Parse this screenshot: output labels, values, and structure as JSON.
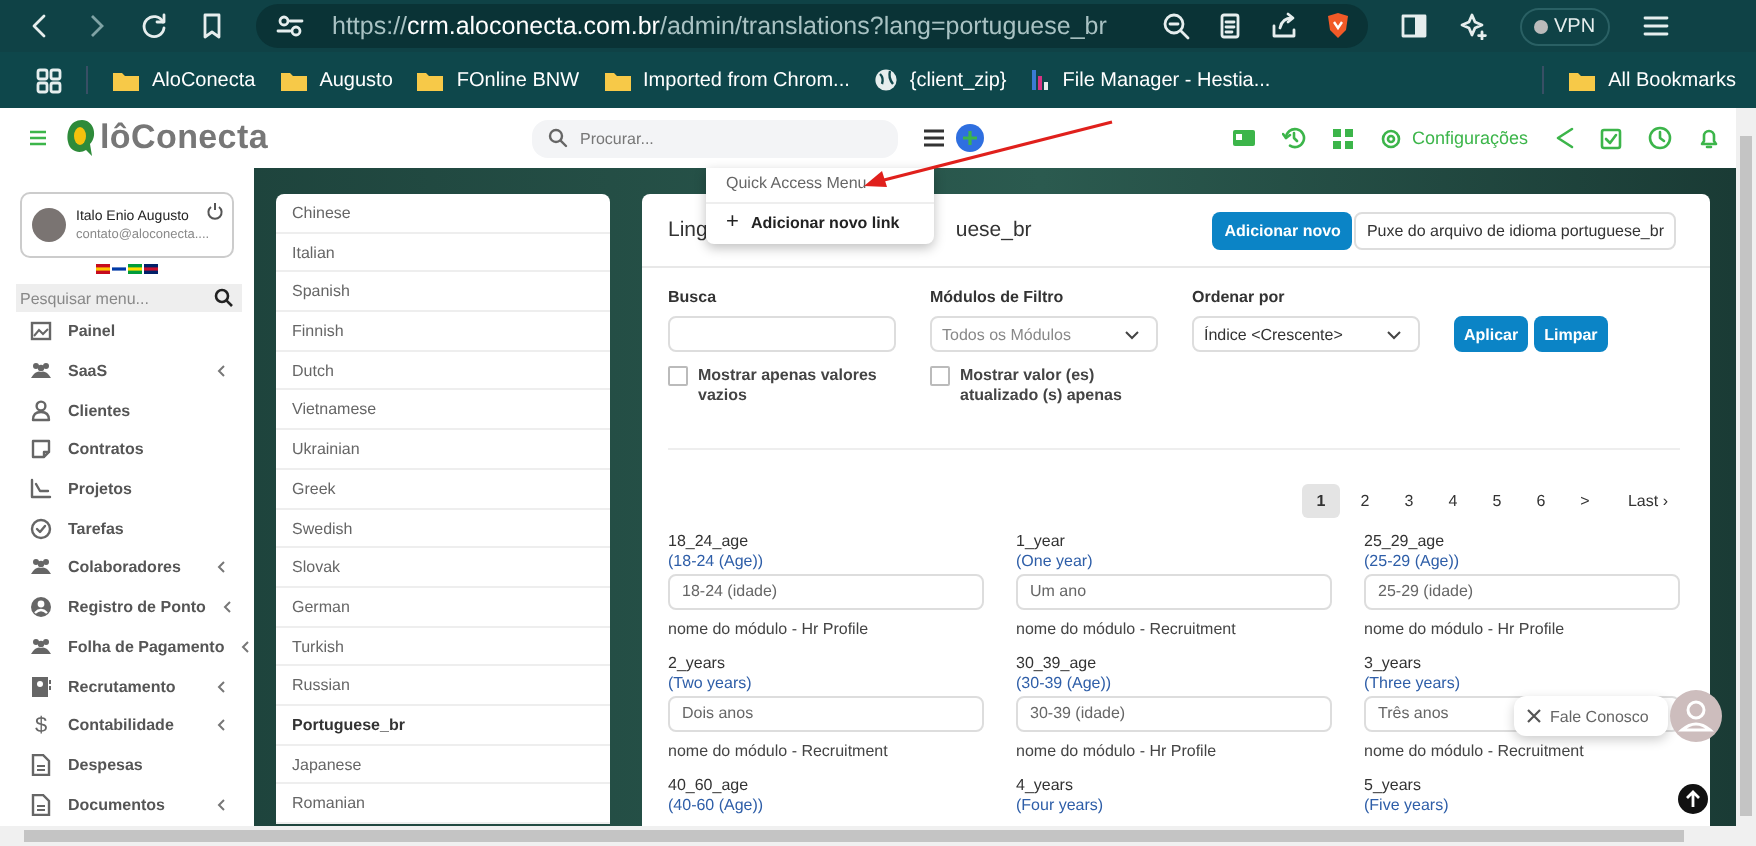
{
  "browser": {
    "url_scheme": "https://",
    "url_host": "crm.aloconecta.com.br",
    "url_path": "/admin/translations?lang=portuguese_br",
    "vpn": "VPN"
  },
  "bookmarks": [
    {
      "kind": "folder",
      "label": "AloConecta"
    },
    {
      "kind": "folder",
      "label": "Augusto"
    },
    {
      "kind": "folder",
      "label": "FOnline BNW"
    },
    {
      "kind": "folder",
      "label": "Imported from Chrom..."
    },
    {
      "kind": "globe",
      "label": "{client_zip}"
    },
    {
      "kind": "site",
      "label": "File Manager - Hestia..."
    }
  ],
  "all_bookmarks": "All Bookmarks",
  "header": {
    "logo": "lôConecta",
    "search_placeholder": "Procurar...",
    "settings": "Configurações"
  },
  "quick_menu": {
    "title": "Quick Access Menu",
    "items": [
      {
        "glyph": "+",
        "label": "Adicionar novo link"
      }
    ]
  },
  "user": {
    "name": "Italo Enio Augusto",
    "email": "contato@aloconecta...."
  },
  "sidebar": {
    "search_placeholder": "Pesquisar menu...",
    "items": [
      {
        "kind": "image",
        "label": "Painel",
        "submenu": false
      },
      {
        "kind": "people",
        "label": "SaaS",
        "submenu": true
      },
      {
        "kind": "person",
        "label": "Clientes",
        "submenu": false
      },
      {
        "kind": "note",
        "label": "Contratos",
        "submenu": false
      },
      {
        "kind": "chart",
        "label": "Projetos",
        "submenu": false
      },
      {
        "kind": "check",
        "label": "Tarefas",
        "submenu": false
      },
      {
        "kind": "people",
        "label": "Colaboradores",
        "submenu": true
      },
      {
        "kind": "badge",
        "label": "Registro de Ponto",
        "submenu": true
      },
      {
        "kind": "people",
        "label": "Folha de Pagamento",
        "submenu": true
      },
      {
        "kind": "card",
        "label": "Recrutamento",
        "submenu": true
      },
      {
        "kind": "glyph",
        "glyph": "$",
        "label": "Contabilidade",
        "submenu": true
      },
      {
        "kind": "document",
        "label": "Despesas",
        "submenu": false
      },
      {
        "kind": "document",
        "label": "Documentos",
        "submenu": true
      }
    ]
  },
  "languages": [
    {
      "label": "Chinese",
      "selected": false
    },
    {
      "label": "Italian",
      "selected": false
    },
    {
      "label": "Spanish",
      "selected": false
    },
    {
      "label": "Finnish",
      "selected": false
    },
    {
      "label": "Dutch",
      "selected": false
    },
    {
      "label": "Vietnamese",
      "selected": false
    },
    {
      "label": "Ukrainian",
      "selected": false
    },
    {
      "label": "Greek",
      "selected": false
    },
    {
      "label": "Swedish",
      "selected": false
    },
    {
      "label": "Slovak",
      "selected": false
    },
    {
      "label": "German",
      "selected": false
    },
    {
      "label": "Turkish",
      "selected": false
    },
    {
      "label": "Russian",
      "selected": false
    },
    {
      "label": "Portuguese_br",
      "selected": true
    },
    {
      "label": "Japanese",
      "selected": false
    },
    {
      "label": "Romanian",
      "selected": false
    }
  ],
  "page": {
    "title_start": "Ling",
    "title_end": "uese_br",
    "add_button": "Adicionar novo",
    "pull_button": "Puxe do arquivo de idioma portuguese_br"
  },
  "filters": {
    "search_label": "Busca",
    "modules_label": "Módulos de Filtro",
    "modules_value": "Todos os Módulos",
    "order_label": "Ordenar por",
    "order_value": "Índice <Crescente>",
    "apply": "Aplicar",
    "clear": "Limpar",
    "checkboxes": [
      {
        "label": "Mostrar apenas valores vazios",
        "checked": false
      },
      {
        "label": "Mostrar valor (es) atualizado (s) apenas",
        "checked": false
      }
    ]
  },
  "pagination": [
    {
      "label": "1",
      "selected": true
    },
    {
      "label": "2",
      "selected": false
    },
    {
      "label": "3",
      "selected": false
    },
    {
      "label": "4",
      "selected": false
    },
    {
      "label": "5",
      "selected": false
    },
    {
      "label": "6",
      "selected": false
    },
    {
      "label": ">",
      "selected": false
    },
    {
      "label": "Last ›",
      "selected": false
    }
  ],
  "translations": [
    {
      "key": "18_24_age",
      "english": "(18-24 (Age))",
      "value": "18-24 (idade)",
      "module": "nome do módulo - Hr Profile"
    },
    {
      "key": "1_year",
      "english": "(One year)",
      "value": "Um ano",
      "module": "nome do módulo - Recruitment"
    },
    {
      "key": "25_29_age",
      "english": "(25-29 (Age))",
      "value": "25-29 (idade)",
      "module": "nome do módulo - Hr Profile"
    },
    {
      "key": "2_years",
      "english": "(Two years)",
      "value": "Dois anos",
      "module": "nome do módulo - Recruitment"
    },
    {
      "key": "30_39_age",
      "english": "(30-39 (Age))",
      "value": "30-39 (idade)",
      "module": "nome do módulo - Hr Profile"
    },
    {
      "key": "3_years",
      "english": "(Three years)",
      "value": "Três anos",
      "module": "nome do módulo - Recruitment"
    },
    {
      "key": "40_60_age",
      "english": "(40-60 (Age))"
    },
    {
      "key": "4_years",
      "english": "(Four years)"
    },
    {
      "key": "5_years",
      "english": "(Five years)"
    }
  ],
  "chat": {
    "label": "Fale Conosco"
  }
}
